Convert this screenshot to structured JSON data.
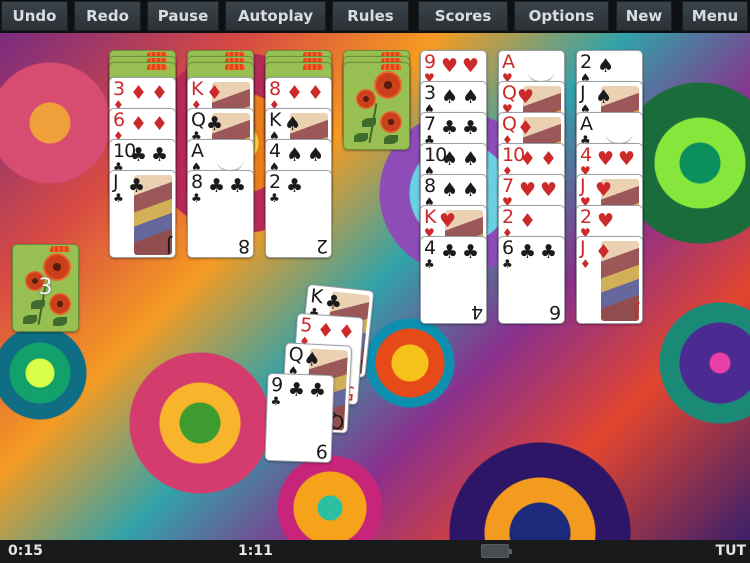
{
  "toolbar": {
    "buttons": [
      {
        "id": "undo",
        "label": "Undo"
      },
      {
        "id": "redo",
        "label": "Redo"
      },
      {
        "id": "pause",
        "label": "Pause"
      },
      {
        "id": "autoplay",
        "label": "Autoplay"
      },
      {
        "id": "rules",
        "label": "Rules"
      },
      {
        "id": "scores",
        "label": "Scores"
      },
      {
        "id": "options",
        "label": "Options"
      },
      {
        "id": "new",
        "label": "New"
      },
      {
        "id": "menu",
        "label": "Menu"
      }
    ]
  },
  "tableau": [
    {
      "facedown": 3,
      "cards": [
        {
          "rank": "3",
          "suit": "♦",
          "color": "red"
        },
        {
          "rank": "6",
          "suit": "♦",
          "color": "red"
        },
        {
          "rank": "10",
          "suit": "♣",
          "color": "black"
        },
        {
          "rank": "J",
          "suit": "♣",
          "color": "black"
        }
      ]
    },
    {
      "facedown": 3,
      "cards": [
        {
          "rank": "K",
          "suit": "♦",
          "color": "red"
        },
        {
          "rank": "Q",
          "suit": "♣",
          "color": "black"
        },
        {
          "rank": "A",
          "suit": "♠",
          "color": "black"
        },
        {
          "rank": "8",
          "suit": "♣",
          "color": "black"
        }
      ]
    },
    {
      "facedown": 3,
      "cards": [
        {
          "rank": "8",
          "suit": "♦",
          "color": "red"
        },
        {
          "rank": "K",
          "suit": "♠",
          "color": "black"
        },
        {
          "rank": "4",
          "suit": "♠",
          "color": "black"
        },
        {
          "rank": "2",
          "suit": "♣",
          "color": "black"
        }
      ]
    },
    {
      "facedown": 3,
      "cards": []
    },
    {
      "facedown": 0,
      "cards": [
        {
          "rank": "9",
          "suit": "♥",
          "color": "red"
        },
        {
          "rank": "3",
          "suit": "♠",
          "color": "black"
        },
        {
          "rank": "7",
          "suit": "♣",
          "color": "black"
        },
        {
          "rank": "10",
          "suit": "♠",
          "color": "black"
        },
        {
          "rank": "8",
          "suit": "♠",
          "color": "black"
        },
        {
          "rank": "K",
          "suit": "♥",
          "color": "red"
        },
        {
          "rank": "4",
          "suit": "♣",
          "color": "black"
        }
      ]
    },
    {
      "facedown": 0,
      "cards": [
        {
          "rank": "A",
          "suit": "♥",
          "color": "red"
        },
        {
          "rank": "Q",
          "suit": "♥",
          "color": "red"
        },
        {
          "rank": "Q",
          "suit": "♦",
          "color": "red"
        },
        {
          "rank": "10",
          "suit": "♦",
          "color": "red"
        },
        {
          "rank": "7",
          "suit": "♥",
          "color": "red"
        },
        {
          "rank": "2",
          "suit": "♦",
          "color": "red"
        },
        {
          "rank": "6",
          "suit": "♣",
          "color": "black"
        }
      ]
    },
    {
      "facedown": 0,
      "cards": [
        {
          "rank": "2",
          "suit": "♠",
          "color": "black"
        },
        {
          "rank": "J",
          "suit": "♠",
          "color": "black"
        },
        {
          "rank": "A",
          "suit": "♣",
          "color": "black"
        },
        {
          "rank": "4",
          "suit": "♥",
          "color": "red"
        },
        {
          "rank": "J",
          "suit": "♥",
          "color": "red"
        },
        {
          "rank": "2",
          "suit": "♥",
          "color": "red"
        },
        {
          "rank": "J",
          "suit": "♦",
          "color": "red"
        }
      ]
    }
  ],
  "stock": {
    "count": "3"
  },
  "waste": [
    {
      "rank": "K",
      "suit": "♣",
      "color": "black"
    },
    {
      "rank": "5",
      "suit": "♦",
      "color": "red"
    },
    {
      "rank": "Q",
      "suit": "♠",
      "color": "black"
    },
    {
      "rank": "9",
      "suit": "♣",
      "color": "black"
    }
  ],
  "status": {
    "elapsed": "0:15",
    "clock": "1:11",
    "mode": "TUT"
  }
}
